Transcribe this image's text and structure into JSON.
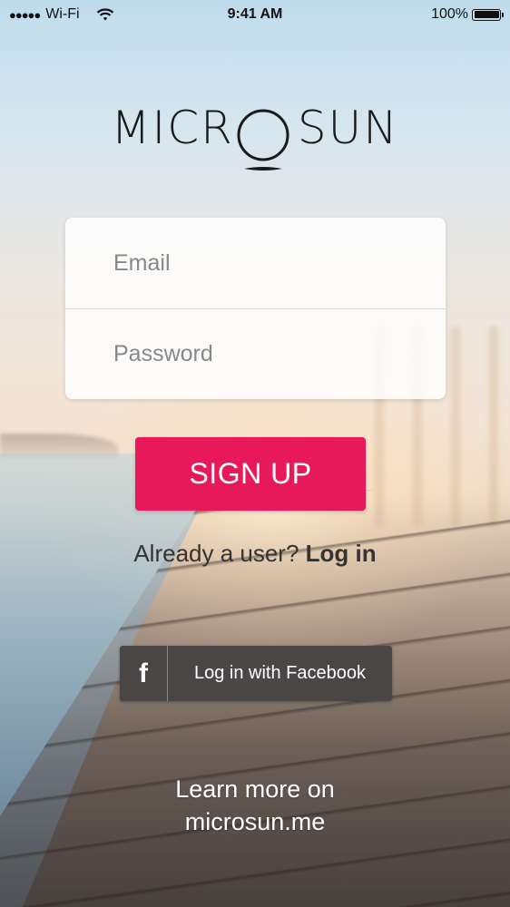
{
  "status_bar": {
    "signal_dots": "●●●●●",
    "carrier": "Wi-Fi",
    "wifi_icon": "wifi-icon",
    "time": "9:41 AM",
    "battery_percent": "100%",
    "battery_level": 1.0
  },
  "brand": {
    "logo_left": "MICR",
    "logo_right": "SUN",
    "accent_color": "#e8195a"
  },
  "form": {
    "email_placeholder": "Email",
    "password_placeholder": "Password",
    "email_value": "",
    "password_value": ""
  },
  "signup": {
    "label": "SIGN UP"
  },
  "login_prompt": {
    "text": "Already a user?",
    "link": "Log in"
  },
  "facebook": {
    "icon": "facebook-icon",
    "glyph": "f",
    "label": "Log in with Facebook"
  },
  "learn_more": {
    "line1": "Learn more on",
    "line2": "microsun.me"
  }
}
